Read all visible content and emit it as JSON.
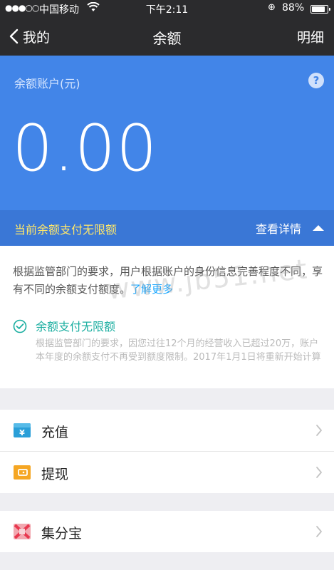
{
  "status_bar": {
    "signal": "●●●○○",
    "carrier": "中国移动",
    "wifi": "wifi-icon",
    "time": "下午2:11",
    "lock": "orientation-lock-icon",
    "battery_pct": "88%",
    "battery_level": 0.88
  },
  "nav": {
    "back_label": "我的",
    "title": "余额",
    "detail_label": "明细"
  },
  "balance": {
    "account_label": "余额账户(元)",
    "help_icon": "?",
    "amount": "0.00"
  },
  "limit": {
    "text": "当前余额支付无限额",
    "view_detail_label": "查看详情"
  },
  "info": {
    "description": "根据监管部门的要求，用户根据账户的身份信息完善程度不同，享有不同的余额支付额度。",
    "learn_more": "了解更多",
    "check_title": "余额支付无限额",
    "check_desc": "根据监管部门的要求，因您过往12个月的经营收入已超过20万，账户本年度的余额支付不再受到额度限制。2017年1月1日将重新开始计算"
  },
  "menu": {
    "recharge": "充值",
    "withdraw": "提现",
    "jifenbao": "集分宝"
  },
  "watermark": "www.jb51.net",
  "colors": {
    "nav_bg": "#2b2b2d",
    "card_blue": "#4285e8",
    "limit_blue": "#3a77d6",
    "limit_yellow": "#ffe76a",
    "teal": "#1aaea0",
    "link_blue": "#1aa7ff"
  }
}
